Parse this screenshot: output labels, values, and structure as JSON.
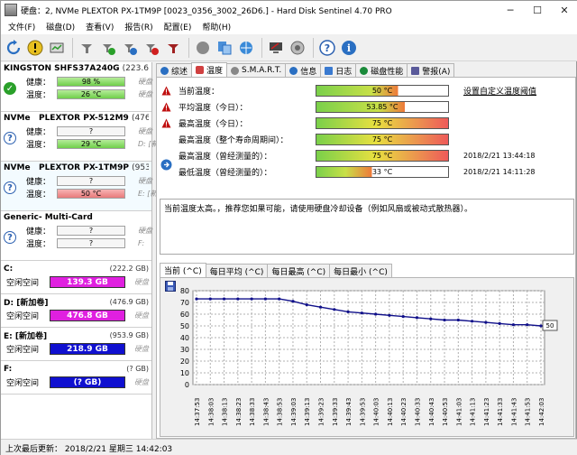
{
  "title": "硬盘：2, NVMe   PLEXTOR PX-1TM9P [0023_0356_3002_26D6.]  -  Hard Disk Sentinel 4.70 PRO",
  "menu": [
    "文件(F)",
    "磁盘(D)",
    "查看(V)",
    "报告(R)",
    "配置(E)",
    "帮助(H)"
  ],
  "disks": [
    {
      "type": "",
      "model": "KINGSTON SHFS37A240G",
      "cap": "(223.6 G",
      "status": "ok",
      "health_label": "健康：",
      "health": "98 %",
      "health_pct": 98,
      "health_tail": "硬盘",
      "temp_label": "温度：",
      "temp": "26 °C",
      "temp_state": "green",
      "temp_tail": "硬盘"
    },
    {
      "type": "NVMe",
      "model": "PLEXTOR PX-512M9",
      "cap": "(476.9",
      "status": "unknown",
      "health_label": "健康：",
      "health": "?",
      "health_pct": 0,
      "health_tail": "硬盘",
      "temp_label": "温度：",
      "temp": "29 °C",
      "temp_state": "green",
      "temp_tail": "D: [新"
    },
    {
      "type": "NVMe",
      "model": "PLEXTOR PX-1TM9P",
      "cap": "(953.9",
      "status": "unknown",
      "health_label": "健康：",
      "health": "?",
      "health_pct": 0,
      "health_tail": "硬盘",
      "temp_label": "温度：",
      "temp": "50 °C",
      "temp_state": "red",
      "temp_tail": "E: [新"
    },
    {
      "type": "",
      "model": "Generic- Multi-Card",
      "cap": "",
      "status": "unknown",
      "health_label": "健康：",
      "health": "?",
      "health_pct": 0,
      "health_tail": "硬盘",
      "temp_label": "温度：",
      "temp": "?",
      "temp_state": "none",
      "temp_tail": "F:"
    }
  ],
  "volumes": [
    {
      "name": "C:",
      "total": "(222.2 GB)",
      "free_label": "空闲空间",
      "free": "139.3 GB",
      "color": "#e020e0",
      "tail": "硬盘"
    },
    {
      "name": "D: [新加卷]",
      "total": "(476.9 GB)",
      "free_label": "空闲空间",
      "free": "476.8 GB",
      "color": "#e020e0",
      "tail": "硬盘"
    },
    {
      "name": "E: [新加卷]",
      "total": "(953.9 GB)",
      "free_label": "空闲空间",
      "free": "218.9 GB",
      "color": "#1010d0",
      "tail": "硬盘"
    },
    {
      "name": "F:",
      "total": "(? GB)",
      "free_label": "空闲空间",
      "free": "(? GB)",
      "color": "#1010d0",
      "tail": "硬盘"
    }
  ],
  "tabs": [
    "综述",
    "温度",
    "S.M.A.R.T.",
    "信息",
    "日志",
    "磁盘性能",
    "警报(A)"
  ],
  "temp_rows": [
    {
      "label": "当前温度：",
      "value": "50 °C",
      "level": 0.62,
      "warn": true,
      "date": "",
      "link": "设置自定义温度阈值"
    },
    {
      "label": "平均温度（今日）：",
      "value": "53.85 °C",
      "level": 0.67,
      "warn": true,
      "date": "",
      "link": ""
    },
    {
      "label": "最高温度（今日）：",
      "value": "75 °C",
      "level": 1.0,
      "warn": true,
      "date": "",
      "link": ""
    },
    {
      "label": "最高温度（整个寿命周期间）：",
      "value": "75 °C",
      "level": 1.0,
      "warn": false,
      "date": "",
      "link": ""
    },
    {
      "label": "最高温度（曾经测量的）：",
      "value": "75 °C",
      "level": 1.0,
      "warn": false,
      "date": "2018/2/21 13:44:18",
      "link": ""
    },
    {
      "label": "最低温度（曾经测量的）：",
      "value": "33 °C",
      "level": 0.42,
      "warn": false,
      "date": "2018/2/21 14:11:28",
      "link": ""
    }
  ],
  "note": "当前温度太高。，推荐您如果可能，请使用硬盘冷却设备（例如风扇或被动式散热器）。",
  "chart_tabs": [
    "当前 (^C)",
    "每日平均 (^C)",
    "每日最高 (^C)",
    "每日最小 (^C)"
  ],
  "chart_data": {
    "type": "line",
    "ylim": [
      0,
      80
    ],
    "yticks": [
      0,
      10,
      20,
      30,
      40,
      50,
      60,
      70,
      80
    ],
    "x": [
      "14:37:53",
      "14:38:03",
      "14:38:13",
      "14:38:23",
      "14:38:33",
      "14:38:43",
      "14:38:53",
      "14:39:03",
      "14:39:13",
      "14:39:23",
      "14:39:33",
      "14:39:43",
      "14:39:53",
      "14:40:03",
      "14:40:13",
      "14:40:23",
      "14:40:33",
      "14:40:43",
      "14:40:53",
      "14:41:03",
      "14:41:13",
      "14:41:23",
      "14:41:33",
      "14:41:43",
      "14:41:53",
      "14:42:03"
    ],
    "values": [
      73,
      73,
      73,
      73,
      73,
      73,
      73,
      71,
      68,
      66,
      64,
      62,
      61,
      60,
      59,
      58,
      57,
      56,
      55,
      55,
      54,
      53,
      52,
      51,
      51,
      50
    ],
    "last_label": "50",
    "colors": {
      "line": "#10108a",
      "grid": "#b0b0b0",
      "plot": "#ffffff"
    }
  },
  "status": "上次最后更新：  2018/2/21 星期三 14:42:03"
}
